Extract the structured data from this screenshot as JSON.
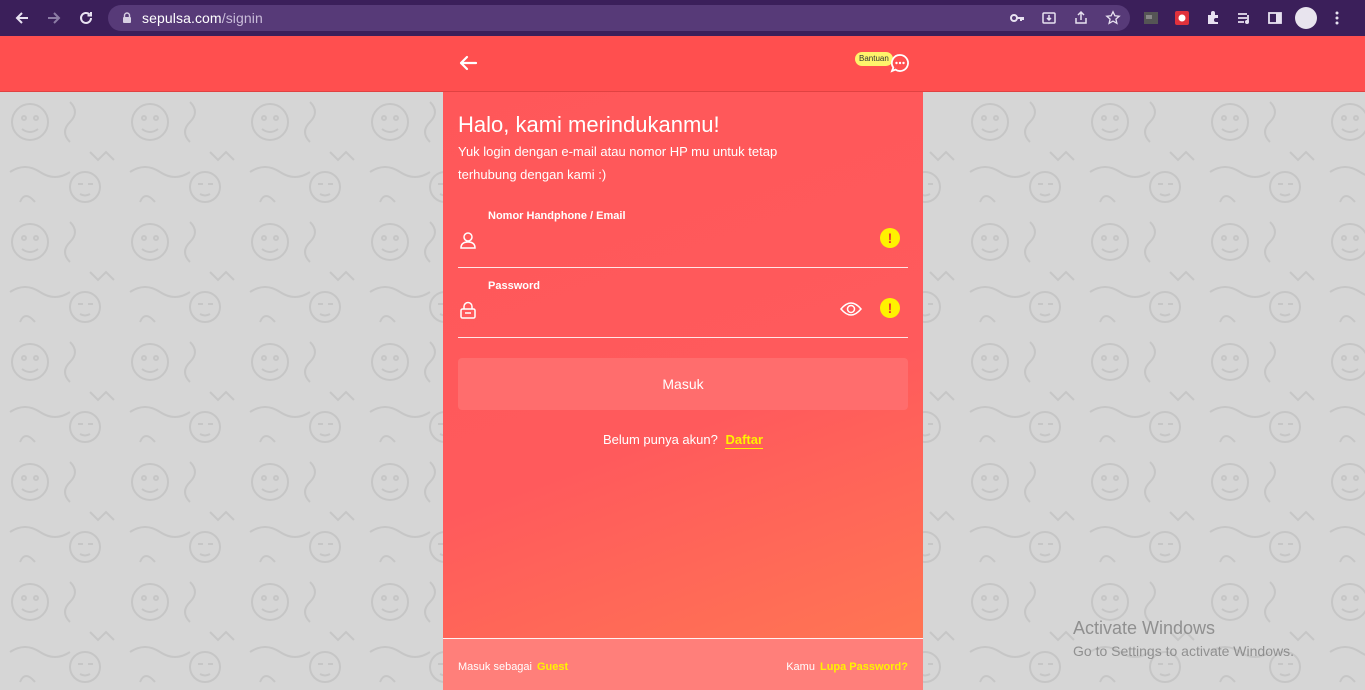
{
  "browser": {
    "url_domain": "sepulsa.com",
    "url_path": "/signin"
  },
  "header": {
    "help_badge": "Bantuan"
  },
  "login": {
    "title": "Halo, kami merindukanmu!",
    "subtitle": "Yuk login dengan e-mail atau nomor HP mu untuk tetap terhubung dengan kami :)",
    "phone_email_label": "Nomor Handphone / Email",
    "phone_email_value": "",
    "password_label": "Password",
    "password_value": "",
    "warning_symbol": "!",
    "submit_label": "Masuk",
    "register_prompt": "Belum punya akun?",
    "register_link": "Daftar"
  },
  "footer": {
    "guest_prefix": "Masuk sebagai",
    "guest_link": "Guest",
    "forgot_prefix": "Kamu",
    "forgot_link": "Lupa Password?"
  },
  "watermark": {
    "line1": "Activate Windows",
    "line2": "Go to Settings to activate Windows."
  },
  "colors": {
    "primary_red": "#ff4f4f",
    "accent_yellow": "#fff200",
    "browser_frame": "#3b1f5a"
  },
  "icons": {
    "back": "arrow-left-icon",
    "help": "chat-bubble-icon",
    "user": "user-icon",
    "lock": "lock-icon",
    "eye": "eye-icon",
    "warning": "warning-icon"
  }
}
